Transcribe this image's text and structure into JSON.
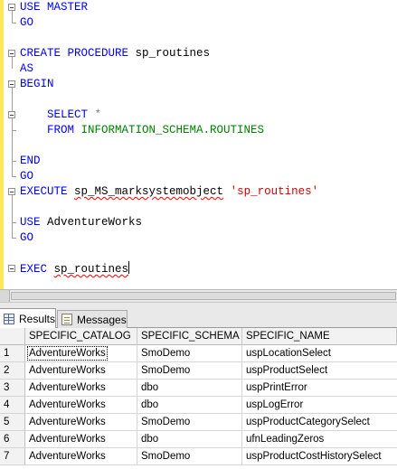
{
  "editor": {
    "lines": [
      {
        "id": "use-master",
        "parts": [
          {
            "t": "USE MASTER",
            "c": "kw"
          }
        ]
      },
      {
        "id": "go-1",
        "parts": [
          {
            "t": "GO",
            "c": "kw"
          }
        ]
      },
      {
        "id": "blank-1",
        "parts": []
      },
      {
        "id": "create-procedure",
        "parts": [
          {
            "t": "CREATE PROCEDURE",
            "c": "kw"
          },
          {
            "t": " sp_routines",
            "c": ""
          }
        ]
      },
      {
        "id": "as",
        "parts": [
          {
            "t": "AS",
            "c": "kw"
          }
        ]
      },
      {
        "id": "begin",
        "parts": [
          {
            "t": "BEGIN",
            "c": "kw"
          }
        ]
      },
      {
        "id": "blank-2",
        "parts": []
      },
      {
        "id": "select-star",
        "parts": [
          {
            "t": "    SELECT",
            "c": "kw"
          },
          {
            "t": " *",
            "c": "gray"
          }
        ]
      },
      {
        "id": "from-routines",
        "parts": [
          {
            "t": "    FROM",
            "c": "kw"
          },
          {
            "t": " INFORMATION_SCHEMA.ROUTINES",
            "c": "green"
          }
        ]
      },
      {
        "id": "blank-3",
        "parts": []
      },
      {
        "id": "end",
        "parts": [
          {
            "t": "END",
            "c": "kw"
          }
        ]
      },
      {
        "id": "go-2",
        "parts": [
          {
            "t": "GO",
            "c": "kw"
          }
        ]
      },
      {
        "id": "execute-mark",
        "parts": [
          {
            "t": "EXECUTE",
            "c": "kw"
          },
          {
            "t": " ",
            "c": ""
          },
          {
            "t": "sp_MS_marksystemobject",
            "c": "squig"
          },
          {
            "t": " ",
            "c": ""
          },
          {
            "t": "'sp_routines'",
            "c": "red"
          }
        ]
      },
      {
        "id": "blank-4",
        "parts": []
      },
      {
        "id": "use-adventureworks",
        "parts": [
          {
            "t": "USE",
            "c": "kw"
          },
          {
            "t": " AdventureWorks",
            "c": ""
          }
        ]
      },
      {
        "id": "go-3",
        "parts": [
          {
            "t": "GO",
            "c": "kw"
          }
        ]
      },
      {
        "id": "blank-5",
        "parts": []
      },
      {
        "id": "exec-routines",
        "parts": [
          {
            "t": "EXEC",
            "c": "kw"
          },
          {
            "t": " ",
            "c": ""
          },
          {
            "t": "sp_routines",
            "c": "squig"
          }
        ]
      }
    ]
  },
  "tabs": {
    "results_label": "Results",
    "messages_label": "Messages",
    "results_icon": "grid-icon",
    "messages_icon": "messages-icon"
  },
  "grid": {
    "columns": [
      "SPECIFIC_CATALOG",
      "SPECIFIC_SCHEMA",
      "SPECIFIC_NAME"
    ],
    "rows": [
      {
        "num": "1",
        "cells": [
          "AdventureWorks",
          "SmoDemo",
          "uspLocationSelect"
        ]
      },
      {
        "num": "2",
        "cells": [
          "AdventureWorks",
          "SmoDemo",
          "uspProductSelect"
        ]
      },
      {
        "num": "3",
        "cells": [
          "AdventureWorks",
          "dbo",
          "uspPrintError"
        ]
      },
      {
        "num": "4",
        "cells": [
          "AdventureWorks",
          "dbo",
          "uspLogError"
        ]
      },
      {
        "num": "5",
        "cells": [
          "AdventureWorks",
          "SmoDemo",
          "uspProductCategorySelect"
        ]
      },
      {
        "num": "6",
        "cells": [
          "AdventureWorks",
          "dbo",
          "ufnLeadingZeros"
        ]
      },
      {
        "num": "7",
        "cells": [
          "AdventureWorks",
          "SmoDemo",
          "uspProductCostHistorySelect"
        ]
      }
    ]
  },
  "colors": {
    "keyword": "#0000ff",
    "system_object": "#008000",
    "string": "#d40000",
    "operator": "#808080",
    "change_bar": "#ffe85a"
  }
}
